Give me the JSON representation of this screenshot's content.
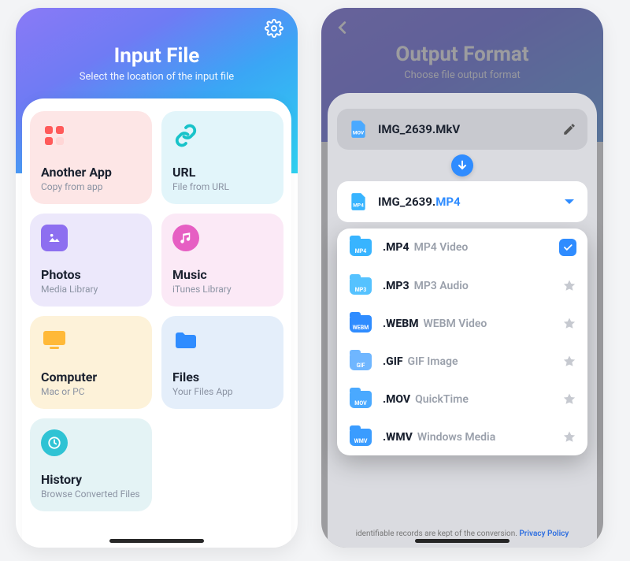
{
  "left": {
    "title": "Input File",
    "subtitle": "Select the location of the input file",
    "tiles": [
      {
        "title": "Another App",
        "sub": "Copy from app"
      },
      {
        "title": "URL",
        "sub": "File from URL"
      },
      {
        "title": "Photos",
        "sub": "Media Library"
      },
      {
        "title": "Music",
        "sub": "iTunes Library"
      },
      {
        "title": "Computer",
        "sub": "Mac or PC"
      },
      {
        "title": "Files",
        "sub": "Your Files App"
      },
      {
        "title": "History",
        "sub": "Browse Converted Files"
      }
    ]
  },
  "right": {
    "title": "Output Format",
    "subtitle": "Choose file output format",
    "source": {
      "badge": "MOV",
      "name": "IMG_2639.MkV"
    },
    "target": {
      "badge": "MP4",
      "name_base": "IMG_2639.",
      "name_ext": "MP4"
    },
    "formats": [
      {
        "badge": "MP4",
        "ext": ".MP4",
        "desc": "MP4 Video",
        "selected": true
      },
      {
        "badge": "MP3",
        "ext": ".MP3",
        "desc": "MP3 Audio",
        "selected": false
      },
      {
        "badge": "WEBM",
        "ext": ".WEBM",
        "desc": "WEBM Video",
        "selected": false
      },
      {
        "badge": "GIF",
        "ext": ".GIF",
        "desc": "GIF Image",
        "selected": false
      },
      {
        "badge": "MOV",
        "ext": ".MOV",
        "desc": "QuickTime",
        "selected": false
      },
      {
        "badge": "WMV",
        "ext": ".WMV",
        "desc": "Windows Media",
        "selected": false
      }
    ],
    "footer_text": "identifiable records are kept of the conversion. ",
    "footer_link": "Privacy Policy",
    "badge_colors": {
      "MP4": "#38b4ff",
      "MP3": "#55c2ff",
      "WEBM": "#2f8cff",
      "GIF": "#6fb6ff",
      "MOV": "#4aa9ff",
      "WMV": "#3a9cff"
    }
  }
}
